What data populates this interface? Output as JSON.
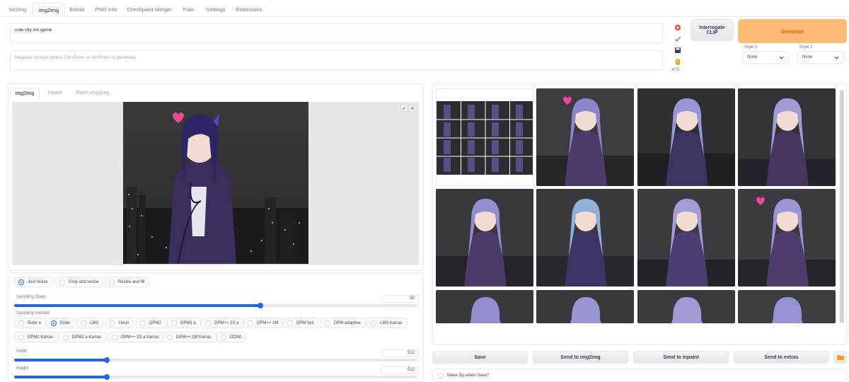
{
  "tabs": [
    {
      "label": "txt2img",
      "active": false
    },
    {
      "label": "img2img",
      "active": true
    },
    {
      "label": "Extras",
      "active": false
    },
    {
      "label": "PNG Info",
      "active": false
    },
    {
      "label": "Checkpoint Merger",
      "active": false
    },
    {
      "label": "Train",
      "active": false
    },
    {
      "label": "Settings",
      "active": false
    },
    {
      "label": "Extensions",
      "active": false
    }
  ],
  "prompt": {
    "value": "cute city oni game"
  },
  "negative_prompt": {
    "value": "",
    "placeholder": "Negative prompt (press Ctrl+Enter or Alt+Enter to generate)"
  },
  "token_counter": "4/75",
  "tool_icons": [
    "paste-icon",
    "check-icon",
    "save-style-icon",
    "clipboard-icon"
  ],
  "interrogate_button": {
    "line1": "Interrogate",
    "line2": "CLIP"
  },
  "generate_button": {
    "label": "Generate",
    "color": "#fdba74",
    "text_color": "#ea580c"
  },
  "style1": {
    "label": "Style 1",
    "value": "None"
  },
  "style2": {
    "label": "Style 2",
    "value": "None"
  },
  "subtabs": [
    {
      "label": "img2img",
      "active": true
    },
    {
      "label": "Inpaint",
      "active": false
    },
    {
      "label": "Batch img2img",
      "active": false
    }
  ],
  "resize_modes": [
    {
      "label": "Just resize",
      "selected": true
    },
    {
      "label": "Crop and resize",
      "selected": false
    },
    {
      "label": "Resize and fill",
      "selected": false
    }
  ],
  "sampling_steps": {
    "label": "Sampling Steps",
    "value": "92",
    "fraction": 0.61
  },
  "sampling_method": {
    "label": "Sampling method",
    "options": [
      {
        "label": "Euler a",
        "selected": false
      },
      {
        "label": "Euler",
        "selected": true
      },
      {
        "label": "LMS",
        "selected": false
      },
      {
        "label": "Heun",
        "selected": false
      },
      {
        "label": "DPM2",
        "selected": false
      },
      {
        "label": "DPM2 a",
        "selected": false
      },
      {
        "label": "DPM++ 2S a",
        "selected": false
      },
      {
        "label": "DPM++ 2M",
        "selected": false
      },
      {
        "label": "DPM fast",
        "selected": false
      },
      {
        "label": "DPM adaptive",
        "selected": false
      },
      {
        "label": "LMS Karras",
        "selected": false
      },
      {
        "label": "DPM2 Karras",
        "selected": false
      },
      {
        "label": "DPM2 a Karras",
        "selected": false
      },
      {
        "label": "DPM++ 2S a Karras",
        "selected": false
      },
      {
        "label": "DPM++ 2M Karras",
        "selected": false
      },
      {
        "label": "DDIM",
        "selected": false
      }
    ]
  },
  "width": {
    "label": "Width",
    "value": "512",
    "fraction": 0.23
  },
  "height": {
    "label": "Height",
    "value": "512",
    "fraction": 0.23
  },
  "output_buttons": [
    "Save",
    "Send to img2img",
    "Send to inpaint",
    "Send to extras"
  ],
  "folder_icon": "folder-icon",
  "zip_checkbox": {
    "label": "Make Zip when Save?",
    "checked": false
  },
  "image_tool_icons": [
    "edit-icon",
    "close-icon"
  ],
  "colors": {
    "accent": "#2563eb",
    "generate": "#fdba74",
    "border": "#e5e7eb"
  }
}
